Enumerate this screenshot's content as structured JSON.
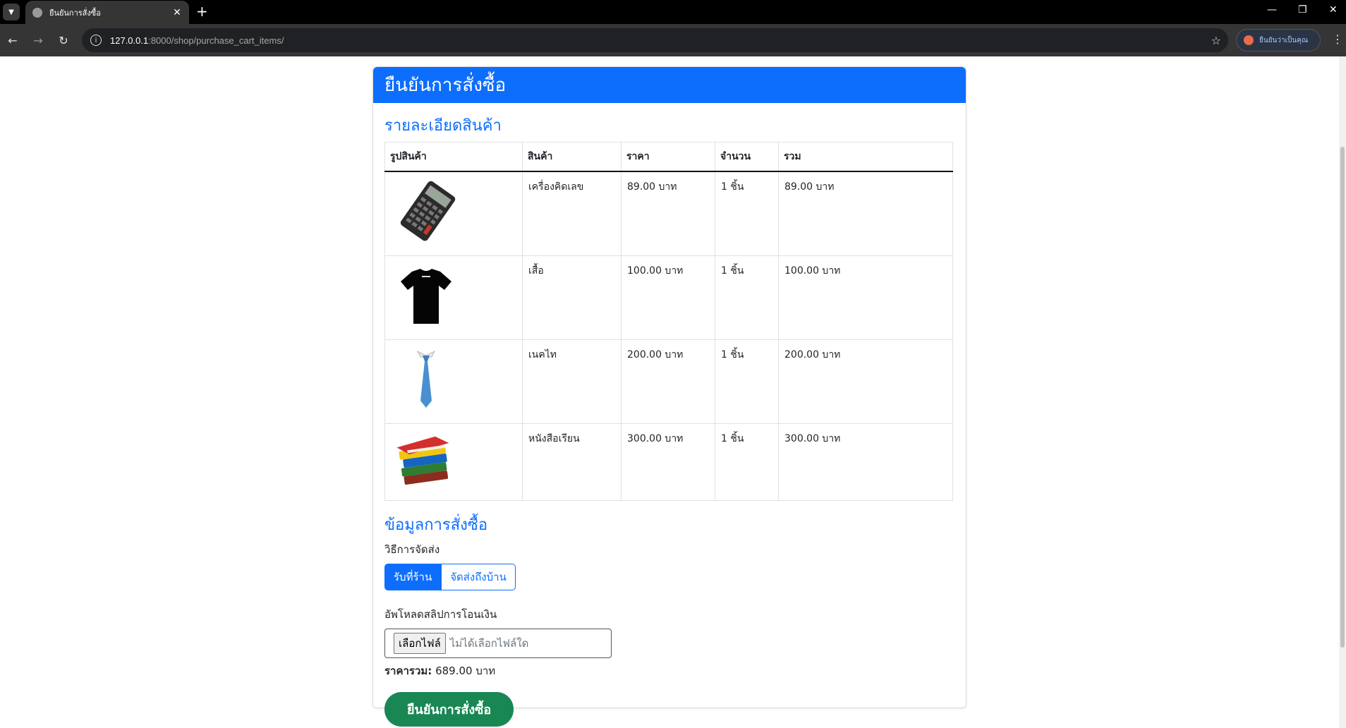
{
  "browser": {
    "tab_title": "ยืนยันการสั่งซื้อ",
    "url_host": "127.0.0.1",
    "url_path": ":8000/shop/purchase_cart_items/",
    "profile_label": "ยืนยันว่าเป็นคุณ",
    "icons": [
      "tab-list-icon",
      "close-icon",
      "plus-icon",
      "minimize-icon",
      "restore-icon",
      "close-window-icon",
      "back-icon",
      "forward-icon",
      "reload-icon",
      "info-icon",
      "star-icon",
      "more-icon"
    ]
  },
  "page": {
    "header": "ยืนยันการสั่งซื้อ",
    "details_heading": "รายละเอียดสินค้า",
    "table": {
      "headers": [
        "รูปสินค้า",
        "สินค้า",
        "ราคา",
        "จำนวน",
        "รวม"
      ],
      "rows": [
        {
          "image": "calculator",
          "name": "เครื่องคิดเลข",
          "price": "89.00 บาท",
          "qty": "1 ชิ้น",
          "total": "89.00 บาท"
        },
        {
          "image": "t-shirt",
          "name": "เสื้อ",
          "price": "100.00 บาท",
          "qty": "1 ชิ้น",
          "total": "100.00 บาท"
        },
        {
          "image": "necktie",
          "name": "เนคไท",
          "price": "200.00 บาท",
          "qty": "1 ชิ้น",
          "total": "200.00 บาท"
        },
        {
          "image": "books",
          "name": "หนังสือเรียน",
          "price": "300.00 บาท",
          "qty": "1 ชิ้น",
          "total": "300.00 บาท"
        }
      ]
    },
    "order_heading": "ข้อมูลการสั่งซื้อ",
    "shipping_label": "วิธีการจัดส่ง",
    "shipping_options": [
      "รับที่ร้าน",
      "จัดส่งถึงบ้าน"
    ],
    "shipping_selected": "รับที่ร้าน",
    "upload_label": "อัพโหลดสลิปการโอนเงิน",
    "file_button": "เลือกไฟล์",
    "file_status": "ไม่ได้เลือกไฟล์ใด",
    "total_label": "ราคารวม:",
    "total_value": "689.00 บาท",
    "submit_label": "ยืนยันการสั่งซื้อ"
  },
  "colors": {
    "primary": "#0d6efd",
    "success": "#198754",
    "chrome": "#353535"
  }
}
